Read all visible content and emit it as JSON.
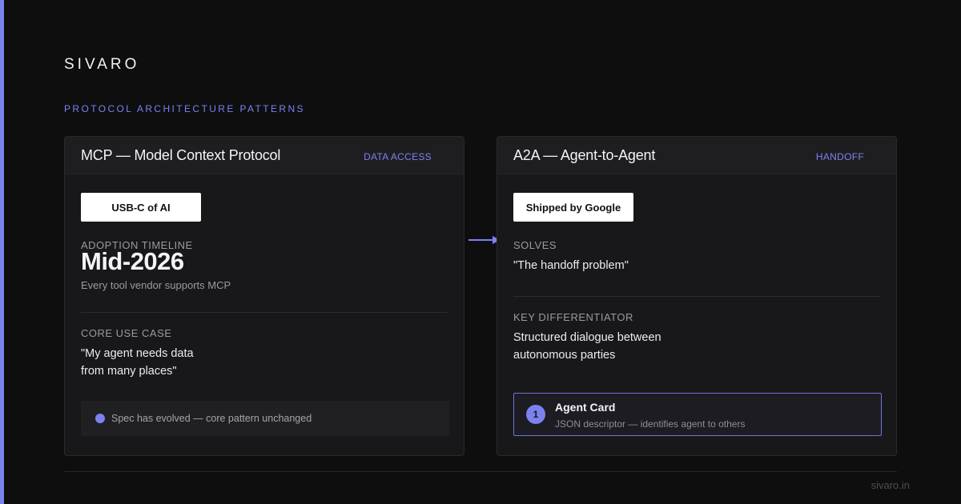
{
  "brand": "SIVARO",
  "section_label": "PROTOCOL ARCHITECTURE PATTERNS",
  "colors": {
    "accent": "#7b82f0",
    "background": "#0e0e0f",
    "card": "#18181a"
  },
  "left_card": {
    "title": "MCP — Model Context Protocol",
    "tag": "DATA ACCESS",
    "pill": "USB-C of AI",
    "timeline_label": "ADOPTION TIMELINE",
    "timeline_value": "Mid-2026",
    "timeline_sub": "Every tool vendor supports MCP",
    "use_case_label": "CORE USE CASE",
    "use_case_lines": [
      "\"My agent needs data",
      "from many places\""
    ],
    "note": "Spec has evolved — core pattern unchanged"
  },
  "connector_icon": "arrow-right-icon",
  "right_card": {
    "title": "A2A — Agent-to-Agent",
    "tag": "HANDOFF",
    "pill": "Shipped by Google",
    "solves_label": "SOLVES",
    "solves_value": "\"The handoff problem\"",
    "diff_label": "KEY DIFFERENTIATOR",
    "diff_lines": [
      "Structured dialogue between",
      "autonomous parties"
    ],
    "agent_card": {
      "number": "1",
      "title": "Agent Card",
      "description": "JSON descriptor — identifies agent to others"
    }
  },
  "footer": {
    "url": "sivaro.in"
  }
}
